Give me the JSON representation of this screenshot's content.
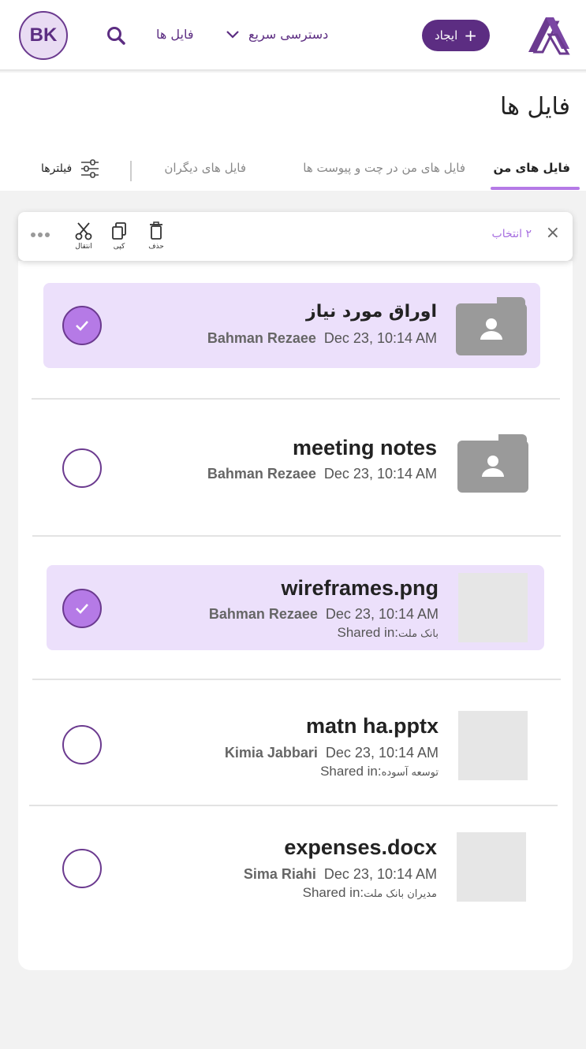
{
  "header": {
    "avatar_initials": "BK",
    "nav_files": "فایل ها",
    "nav_quick_access": "دسترسی سریع",
    "create_label": "ایجاد",
    "icons": {
      "search": "search-icon",
      "chevron": "chevron-down-icon",
      "logo": "app-logo"
    }
  },
  "page": {
    "title": "فایل ها"
  },
  "tabs": {
    "my_files": "فایل های من",
    "chat_attachments": "فایل های من در چت و پیوست ها",
    "others_files": "فایل های دیگران",
    "filters": "فیلترها"
  },
  "action_bar": {
    "selected_count": "۲",
    "selected_label": "انتخاب",
    "delete": "حذف",
    "copy": "کپی",
    "move": "انتقال",
    "close": "×"
  },
  "files": [
    {
      "name": "اوراق مورد نیاز",
      "owner": "Bahman Rezaee",
      "date": "Dec 23, 10:14 AM",
      "type": "folder",
      "selected": true,
      "shared_in": ""
    },
    {
      "name": "meeting notes",
      "owner": "Bahman Rezaee",
      "date": "Dec 23, 10:14 AM",
      "type": "folder",
      "selected": false,
      "shared_in": ""
    },
    {
      "name": "wireframes.png",
      "owner": "Bahman Rezaee",
      "date": "Dec 23, 10:14 AM",
      "type": "file",
      "selected": true,
      "shared_in_label": "Shared in:",
      "shared_in": "بانک ملت"
    },
    {
      "name": "matn ha.pptx",
      "owner": "Kimia Jabbari",
      "date": "Dec 23, 10:14 AM",
      "type": "file",
      "selected": false,
      "shared_in_label": "Shared in:",
      "shared_in": "توسعه آسوده"
    },
    {
      "name": "expenses.docx",
      "owner": "Sima Riahi",
      "date": "Dec 23, 10:14 AM",
      "type": "file",
      "selected": false,
      "shared_in_label": "Shared in:",
      "shared_in": "مدیران بانک ملت"
    }
  ],
  "colors": {
    "brand": "#5c2d82",
    "accent": "#b57ae6",
    "selected_row": "#ece0fb"
  }
}
